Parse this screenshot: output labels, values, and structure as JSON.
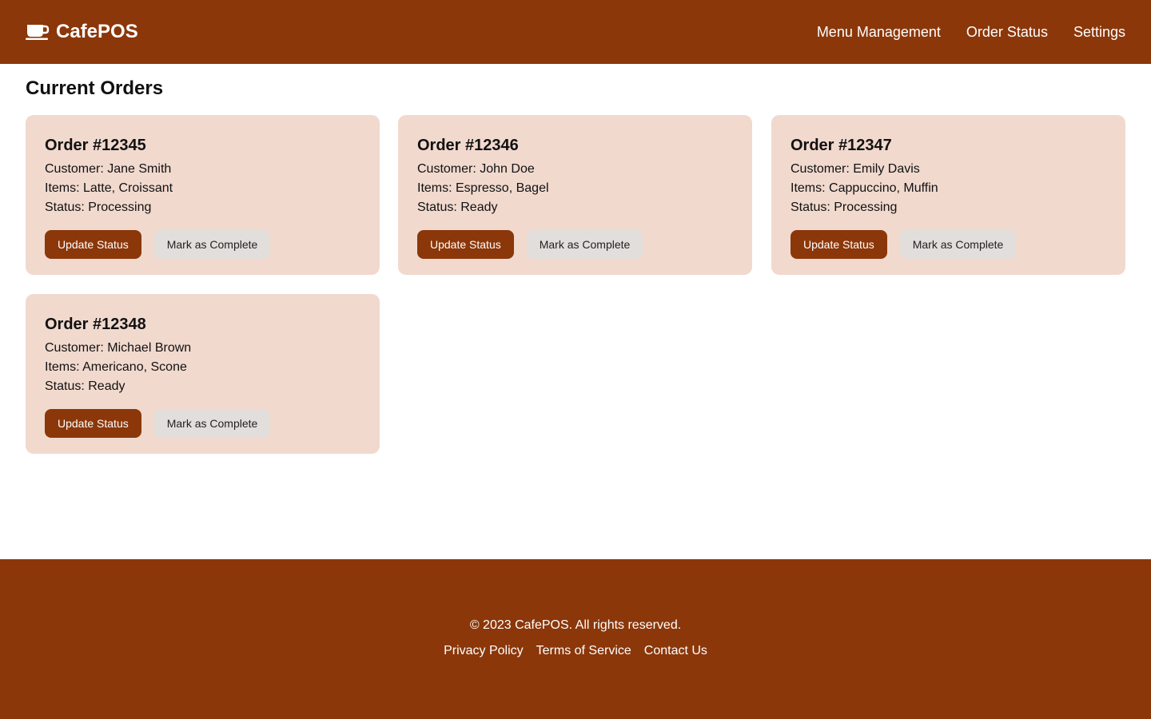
{
  "brand": {
    "name": "CafePOS",
    "icon": "coffee-cup-icon"
  },
  "nav": {
    "items": [
      "Menu Management",
      "Order Status",
      "Settings"
    ]
  },
  "main": {
    "title": "Current Orders",
    "orders": [
      {
        "title": "Order #12345",
        "customer": "Customer: Jane Smith",
        "items": "Items: Latte, Croissant",
        "status": "Status: Processing",
        "update_label": "Update Status",
        "complete_label": "Mark as Complete"
      },
      {
        "title": "Order #12346",
        "customer": "Customer: John Doe",
        "items": "Items: Espresso, Bagel",
        "status": "Status: Ready",
        "update_label": "Update Status",
        "complete_label": "Mark as Complete"
      },
      {
        "title": "Order #12347",
        "customer": "Customer: Emily Davis",
        "items": "Items: Cappuccino, Muffin",
        "status": "Status: Processing",
        "update_label": "Update Status",
        "complete_label": "Mark as Complete"
      },
      {
        "title": "Order #12348",
        "customer": "Customer: Michael Brown",
        "items": "Items: Americano, Scone",
        "status": "Status: Ready",
        "update_label": "Update Status",
        "complete_label": "Mark as Complete"
      }
    ]
  },
  "footer": {
    "copyright": "© 2023 CafePOS. All rights reserved.",
    "links": [
      "Privacy Policy",
      "Terms of Service",
      "Contact Us"
    ]
  },
  "colors": {
    "brand": "#8b370a",
    "card_bg": "#f1d9ce",
    "secondary_button": "#e2dedb"
  }
}
